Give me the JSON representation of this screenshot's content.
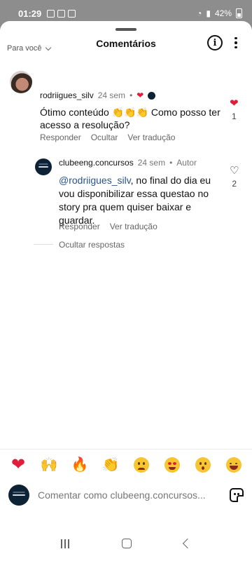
{
  "status_bar": {
    "time": "01:29",
    "battery": "42%"
  },
  "sheet": {
    "title": "Comentários"
  },
  "filter": {
    "label": "Para você"
  },
  "comment": {
    "username": "rodriigues_silv",
    "time": "24 sem",
    "text": "Ótimo conteúdo 👏👏👏 Como posso ter acesso a resolução?",
    "reply_label": "Responder",
    "hide_label": "Ocultar",
    "translate_label": "Ver tradução",
    "like_count": "1"
  },
  "reply": {
    "username": "clubeeng.concursos",
    "time": "24 sem",
    "author_badge": "Autor",
    "mention": "@rodriigues_silv",
    "text": ", no final do dia eu vou disponibilizar essa questao no story pra quem quiser baixar e guardar.",
    "reply_label": "Responder",
    "translate_label": "Ver tradução",
    "like_count": "2"
  },
  "hide_replies": "Ocultar respostas",
  "emoji_bar": [
    "heart",
    "raising-hands",
    "fire",
    "clapping",
    "sad-face",
    "heart-eyes",
    "surprised-face",
    "laughing-face"
  ],
  "input": {
    "placeholder": "Comentar como clubeeng.concursos..."
  },
  "colors": {
    "like_red": "#e01d3b",
    "mention_blue": "#27548e",
    "brand_navy": "#0e2235"
  }
}
